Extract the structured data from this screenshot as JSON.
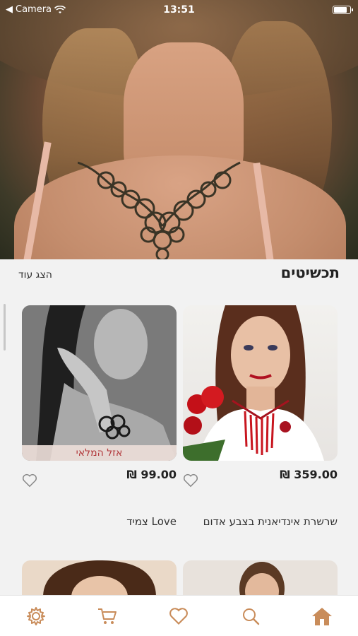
{
  "status_bar": {
    "back_label": "Camera",
    "time": "13:51",
    "battery_level": 0.85
  },
  "hero": {
    "image_description": "model wearing dark floral necklace"
  },
  "section": {
    "title": "תכשיטים",
    "show_more": "הצג עוד"
  },
  "products": [
    {
      "name": "שרשרת אינדיאנית בצבע אדום",
      "price": "₪ 359.00",
      "sold_out": ""
    },
    {
      "name": "צמיד Love",
      "price": "₪ 99.00",
      "sold_out": "אזל המלאי"
    }
  ],
  "nav": {
    "items": [
      "home-icon",
      "search-icon",
      "heart-icon",
      "cart-icon",
      "settings-icon"
    ],
    "accent": "#c98c5a"
  }
}
